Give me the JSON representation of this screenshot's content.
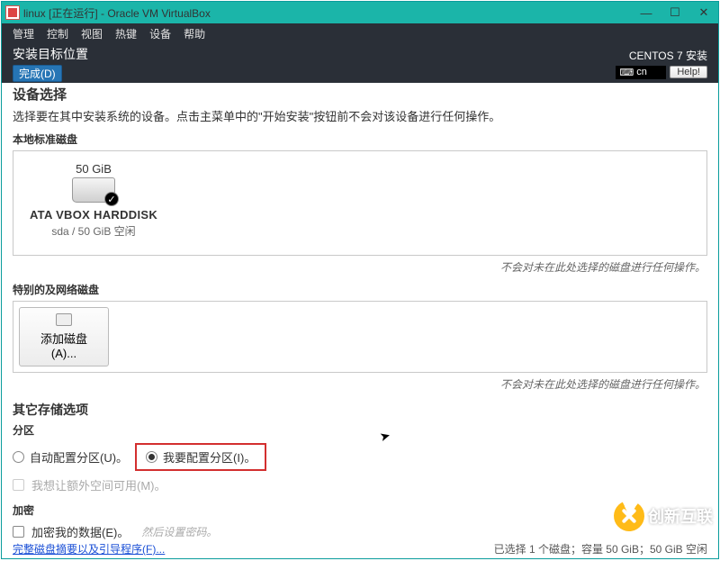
{
  "window": {
    "title": "linux [正在运行] - Oracle VM VirtualBox"
  },
  "menu": {
    "items": [
      "管理",
      "控制",
      "视图",
      "热键",
      "设备",
      "帮助"
    ]
  },
  "installer": {
    "heading": "安装目标位置",
    "done": "完成(D)",
    "product": "CENTOS 7 安装",
    "kbd": "cn",
    "help": "Help!"
  },
  "device": {
    "title": "设备选择",
    "desc": "选择要在其中安装系统的设备。点击主菜单中的\"开始安装\"按钮前不会对该设备进行任何操作。",
    "local_label": "本地标准磁盘",
    "disk": {
      "size": "50 GiB",
      "name": "ATA VBOX HARDDISK",
      "meta": "sda   /   50 GiB 空闲"
    },
    "hint": "不会对未在此处选择的磁盘进行任何操作。",
    "net_label": "特别的及网络磁盘",
    "add_disk": "添加磁盘(A)..."
  },
  "other": {
    "title": "其它存储选项",
    "partition_label": "分区",
    "auto": "自动配置分区(U)。",
    "manual": "我要配置分区(I)。",
    "extra": "我想让额外空间可用(M)。",
    "encrypt_label": "加密",
    "encrypt": "加密我的数据(E)。",
    "encrypt_hint": "然后设置密码。"
  },
  "footer": {
    "link": "完整磁盘摘要以及引导程序(F)...",
    "status": "已选择 1 个磁盘；容量 50 GiB；50 GiB 空闲"
  },
  "watermark": "创新互联"
}
